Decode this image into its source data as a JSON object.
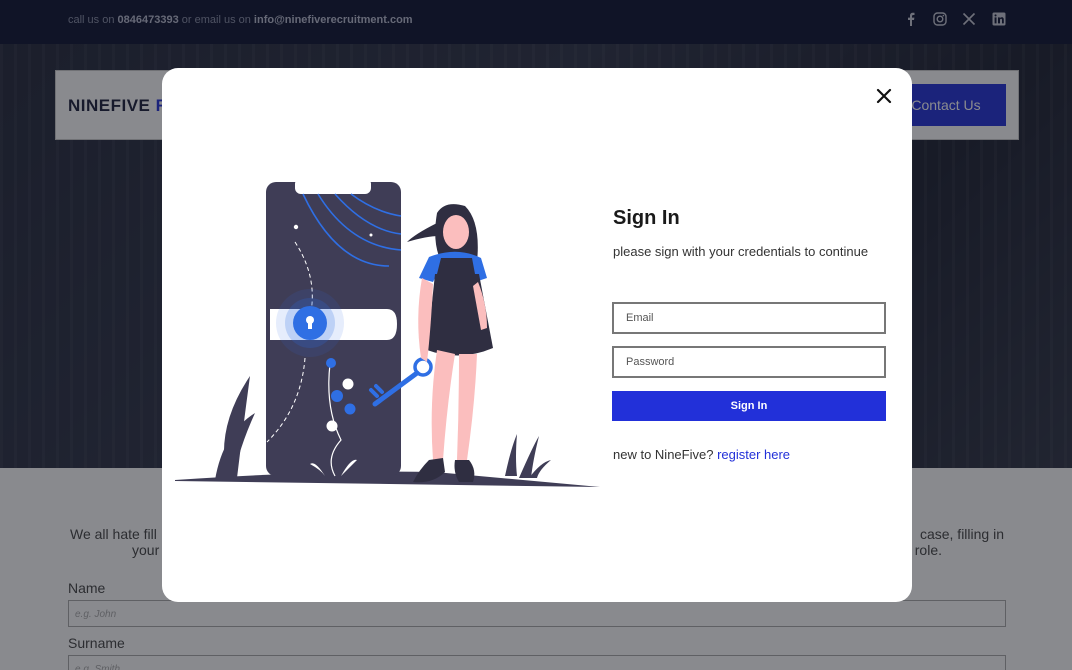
{
  "topbar": {
    "call_prefix": "call us on ",
    "phone": "0846473393",
    "email_prefix": " or email us on ",
    "email": "info@ninefiverecruitment.com",
    "social_icons": [
      "facebook-icon",
      "instagram-icon",
      "x-icon",
      "linkedin-icon"
    ]
  },
  "nav": {
    "logo": "NINEFIVE",
    "logo_accent": "R",
    "contact_button": "Contact Us"
  },
  "page": {
    "intro_left_line1": "We all hate fill",
    "intro_left_line2": "your",
    "intro_right_line1": "case, filling in",
    "intro_right_line2": "role.",
    "name_label": "Name",
    "name_placeholder": "e.g. John",
    "surname_label": "Surname",
    "surname_placeholder": "e.g. Smith"
  },
  "modal": {
    "title": "Sign In",
    "subtitle": "please sign with your credentials to continue",
    "email_placeholder": "Email",
    "password_placeholder": "Password",
    "button": "Sign In",
    "register_prefix": "new to NineFive? ",
    "register_link": "register here"
  },
  "colors": {
    "accent": "#2230d9",
    "topbar": "#0c1230",
    "illustration_dark": "#3f3d56",
    "illustration_blue": "#2f6fe4",
    "skin": "#fbbebe"
  }
}
